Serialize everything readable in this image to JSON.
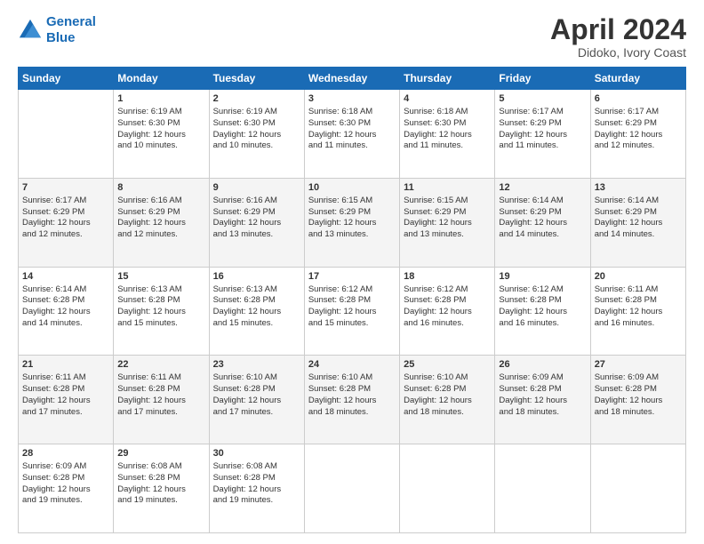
{
  "header": {
    "logo_line1": "General",
    "logo_line2": "Blue",
    "main_title": "April 2024",
    "subtitle": "Didoko, Ivory Coast"
  },
  "calendar": {
    "days_of_week": [
      "Sunday",
      "Monday",
      "Tuesday",
      "Wednesday",
      "Thursday",
      "Friday",
      "Saturday"
    ],
    "weeks": [
      [
        {
          "day": "",
          "lines": []
        },
        {
          "day": "1",
          "lines": [
            "Sunrise: 6:19 AM",
            "Sunset: 6:30 PM",
            "Daylight: 12 hours",
            "and 10 minutes."
          ]
        },
        {
          "day": "2",
          "lines": [
            "Sunrise: 6:19 AM",
            "Sunset: 6:30 PM",
            "Daylight: 12 hours",
            "and 10 minutes."
          ]
        },
        {
          "day": "3",
          "lines": [
            "Sunrise: 6:18 AM",
            "Sunset: 6:30 PM",
            "Daylight: 12 hours",
            "and 11 minutes."
          ]
        },
        {
          "day": "4",
          "lines": [
            "Sunrise: 6:18 AM",
            "Sunset: 6:30 PM",
            "Daylight: 12 hours",
            "and 11 minutes."
          ]
        },
        {
          "day": "5",
          "lines": [
            "Sunrise: 6:17 AM",
            "Sunset: 6:29 PM",
            "Daylight: 12 hours",
            "and 11 minutes."
          ]
        },
        {
          "day": "6",
          "lines": [
            "Sunrise: 6:17 AM",
            "Sunset: 6:29 PM",
            "Daylight: 12 hours",
            "and 12 minutes."
          ]
        }
      ],
      [
        {
          "day": "7",
          "lines": [
            "Sunrise: 6:17 AM",
            "Sunset: 6:29 PM",
            "Daylight: 12 hours",
            "and 12 minutes."
          ]
        },
        {
          "day": "8",
          "lines": [
            "Sunrise: 6:16 AM",
            "Sunset: 6:29 PM",
            "Daylight: 12 hours",
            "and 12 minutes."
          ]
        },
        {
          "day": "9",
          "lines": [
            "Sunrise: 6:16 AM",
            "Sunset: 6:29 PM",
            "Daylight: 12 hours",
            "and 13 minutes."
          ]
        },
        {
          "day": "10",
          "lines": [
            "Sunrise: 6:15 AM",
            "Sunset: 6:29 PM",
            "Daylight: 12 hours",
            "and 13 minutes."
          ]
        },
        {
          "day": "11",
          "lines": [
            "Sunrise: 6:15 AM",
            "Sunset: 6:29 PM",
            "Daylight: 12 hours",
            "and 13 minutes."
          ]
        },
        {
          "day": "12",
          "lines": [
            "Sunrise: 6:14 AM",
            "Sunset: 6:29 PM",
            "Daylight: 12 hours",
            "and 14 minutes."
          ]
        },
        {
          "day": "13",
          "lines": [
            "Sunrise: 6:14 AM",
            "Sunset: 6:29 PM",
            "Daylight: 12 hours",
            "and 14 minutes."
          ]
        }
      ],
      [
        {
          "day": "14",
          "lines": [
            "Sunrise: 6:14 AM",
            "Sunset: 6:28 PM",
            "Daylight: 12 hours",
            "and 14 minutes."
          ]
        },
        {
          "day": "15",
          "lines": [
            "Sunrise: 6:13 AM",
            "Sunset: 6:28 PM",
            "Daylight: 12 hours",
            "and 15 minutes."
          ]
        },
        {
          "day": "16",
          "lines": [
            "Sunrise: 6:13 AM",
            "Sunset: 6:28 PM",
            "Daylight: 12 hours",
            "and 15 minutes."
          ]
        },
        {
          "day": "17",
          "lines": [
            "Sunrise: 6:12 AM",
            "Sunset: 6:28 PM",
            "Daylight: 12 hours",
            "and 15 minutes."
          ]
        },
        {
          "day": "18",
          "lines": [
            "Sunrise: 6:12 AM",
            "Sunset: 6:28 PM",
            "Daylight: 12 hours",
            "and 16 minutes."
          ]
        },
        {
          "day": "19",
          "lines": [
            "Sunrise: 6:12 AM",
            "Sunset: 6:28 PM",
            "Daylight: 12 hours",
            "and 16 minutes."
          ]
        },
        {
          "day": "20",
          "lines": [
            "Sunrise: 6:11 AM",
            "Sunset: 6:28 PM",
            "Daylight: 12 hours",
            "and 16 minutes."
          ]
        }
      ],
      [
        {
          "day": "21",
          "lines": [
            "Sunrise: 6:11 AM",
            "Sunset: 6:28 PM",
            "Daylight: 12 hours",
            "and 17 minutes."
          ]
        },
        {
          "day": "22",
          "lines": [
            "Sunrise: 6:11 AM",
            "Sunset: 6:28 PM",
            "Daylight: 12 hours",
            "and 17 minutes."
          ]
        },
        {
          "day": "23",
          "lines": [
            "Sunrise: 6:10 AM",
            "Sunset: 6:28 PM",
            "Daylight: 12 hours",
            "and 17 minutes."
          ]
        },
        {
          "day": "24",
          "lines": [
            "Sunrise: 6:10 AM",
            "Sunset: 6:28 PM",
            "Daylight: 12 hours",
            "and 18 minutes."
          ]
        },
        {
          "day": "25",
          "lines": [
            "Sunrise: 6:10 AM",
            "Sunset: 6:28 PM",
            "Daylight: 12 hours",
            "and 18 minutes."
          ]
        },
        {
          "day": "26",
          "lines": [
            "Sunrise: 6:09 AM",
            "Sunset: 6:28 PM",
            "Daylight: 12 hours",
            "and 18 minutes."
          ]
        },
        {
          "day": "27",
          "lines": [
            "Sunrise: 6:09 AM",
            "Sunset: 6:28 PM",
            "Daylight: 12 hours",
            "and 18 minutes."
          ]
        }
      ],
      [
        {
          "day": "28",
          "lines": [
            "Sunrise: 6:09 AM",
            "Sunset: 6:28 PM",
            "Daylight: 12 hours",
            "and 19 minutes."
          ]
        },
        {
          "day": "29",
          "lines": [
            "Sunrise: 6:08 AM",
            "Sunset: 6:28 PM",
            "Daylight: 12 hours",
            "and 19 minutes."
          ]
        },
        {
          "day": "30",
          "lines": [
            "Sunrise: 6:08 AM",
            "Sunset: 6:28 PM",
            "Daylight: 12 hours",
            "and 19 minutes."
          ]
        },
        {
          "day": "",
          "lines": []
        },
        {
          "day": "",
          "lines": []
        },
        {
          "day": "",
          "lines": []
        },
        {
          "day": "",
          "lines": []
        }
      ]
    ]
  }
}
